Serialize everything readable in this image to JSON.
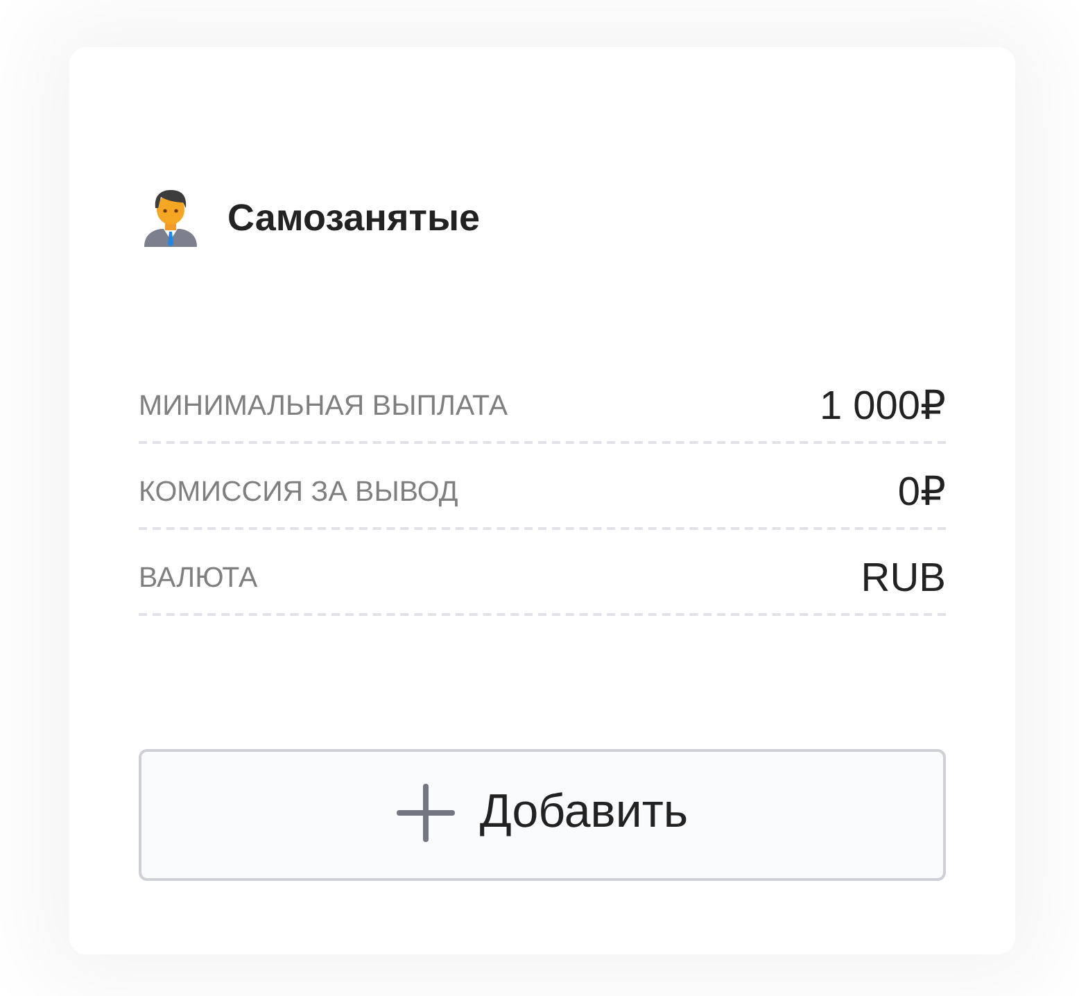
{
  "card": {
    "title": "Самозанятые"
  },
  "rows": [
    {
      "label": "МИНИМАЛЬНАЯ ВЫПЛАТА",
      "value": "1 000₽"
    },
    {
      "label": "КОМИССИЯ ЗА ВЫВОД",
      "value": "0₽"
    },
    {
      "label": "ВАЛЮТА",
      "value": "RUB"
    }
  ],
  "add_button": {
    "label": "Добавить"
  }
}
